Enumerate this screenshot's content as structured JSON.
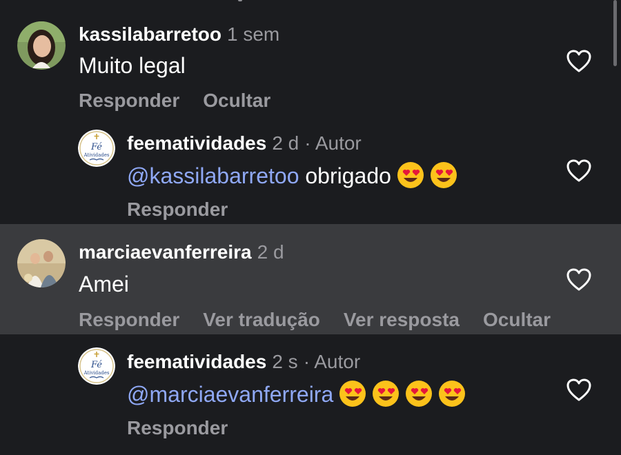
{
  "comments": [
    {
      "username": "kassilabarretoo",
      "time": "1 sem",
      "text": "Muito legal",
      "actions": {
        "reply": "Responder",
        "hide": "Ocultar"
      }
    },
    {
      "username": "feematividades",
      "time": "2 d",
      "author_badge": "· Autor",
      "mention": "@kassilabarretoo",
      "text": " obrigado",
      "emoji_count": 2,
      "logo_text": "Fé em Atividades",
      "actions": {
        "reply": "Responder"
      }
    },
    {
      "username": "marciaevanferreira",
      "time": "2 d",
      "text": "Amei",
      "actions": {
        "reply": "Responder",
        "translate": "Ver tradução",
        "view_replies": "Ver resposta",
        "hide": "Ocultar"
      }
    },
    {
      "username": "feematividades",
      "time": "2 s",
      "author_badge": "· Autor",
      "mention": "@marciaevanferreira",
      "text": "",
      "emoji_count": 4,
      "logo_text": "Fé em Atividades",
      "actions": {
        "reply": "Responder"
      }
    }
  ],
  "icons": {
    "like": "heart-outline-icon",
    "emoji": "heart-eyes-emoji"
  },
  "colors": {
    "background": "#1b1c1f",
    "highlight": "#3a3b3e",
    "mention": "#8fa8f5",
    "secondary_text": "#9a9a9f"
  }
}
